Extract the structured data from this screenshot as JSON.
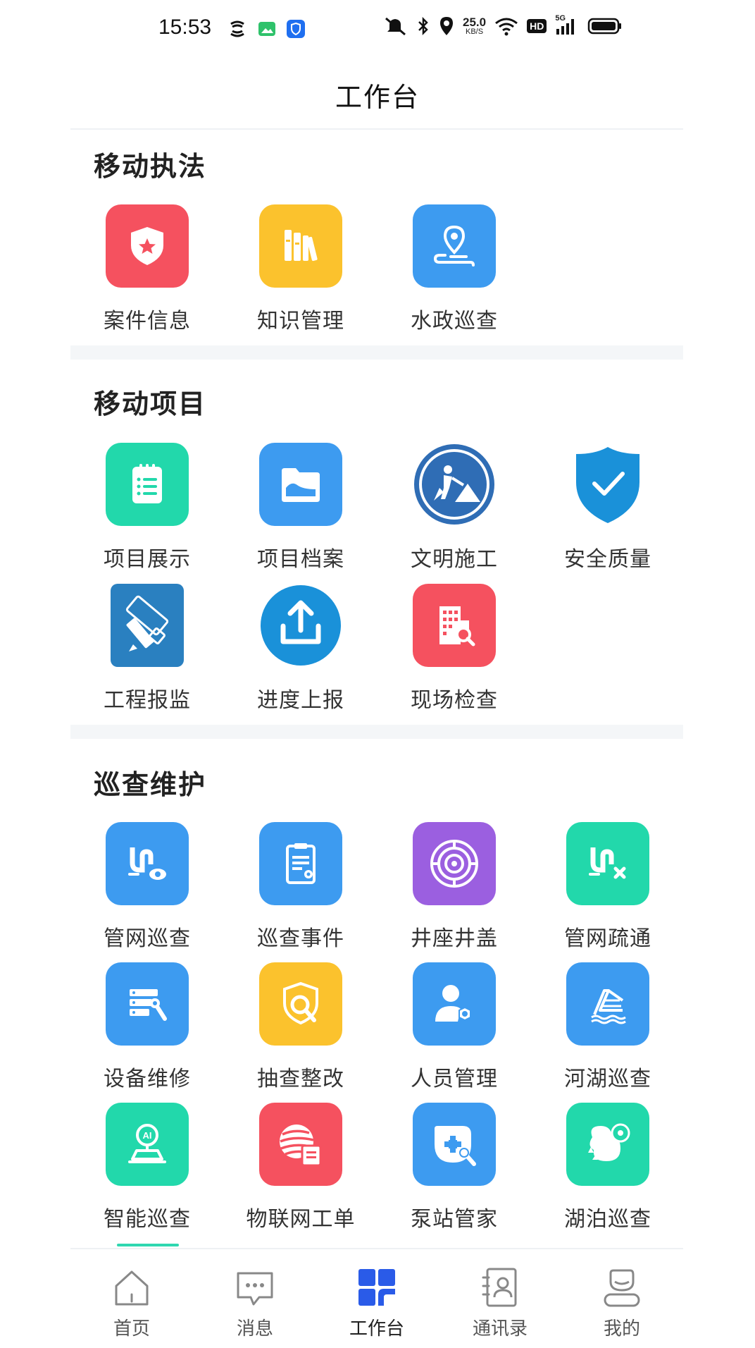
{
  "status_bar": {
    "time": "15:53",
    "network_speed_value": "25.0",
    "network_speed_unit": "KB/S",
    "network_type": "5G",
    "hd_badge": "HD",
    "icons": [
      "nfc-icon",
      "gallery-icon",
      "shield-app-icon",
      "mute-icon",
      "bluetooth-icon",
      "location-icon",
      "wifi-icon",
      "signal-icon",
      "battery-icon"
    ]
  },
  "header": {
    "title": "工作台"
  },
  "sections": [
    {
      "title": "移动执法",
      "items": [
        {
          "label": "案件信息",
          "icon": "police-shield-icon",
          "color": "#f5515f"
        },
        {
          "label": "知识管理",
          "icon": "books-icon",
          "color": "#fbc22d"
        },
        {
          "label": "水政巡查",
          "icon": "map-pin-route-icon",
          "color": "#3d9bf0"
        }
      ]
    },
    {
      "title": "移动项目",
      "items": [
        {
          "label": "项目展示",
          "icon": "clipboard-list-icon",
          "color": "#22d8ab"
        },
        {
          "label": "项目档案",
          "icon": "folder-icon",
          "color": "#3d9bf0"
        },
        {
          "label": "文明施工",
          "icon": "construction-sign-icon",
          "color": "#2f6db5"
        },
        {
          "label": "安全质量",
          "icon": "shield-check-icon",
          "color": "#1a91d9"
        },
        {
          "label": "工程报监",
          "icon": "pencil-ruler-icon",
          "color": "#2a80c0"
        },
        {
          "label": "进度上报",
          "icon": "upload-icon",
          "color": "#1a91d9"
        },
        {
          "label": "现场检查",
          "icon": "building-search-icon",
          "color": "#f5515f"
        }
      ]
    },
    {
      "title": "巡查维护",
      "items": [
        {
          "label": "管网巡查",
          "icon": "pipe-eye-icon",
          "color": "#3d9bf0"
        },
        {
          "label": "巡查事件",
          "icon": "document-eye-icon",
          "color": "#3d9bf0"
        },
        {
          "label": "井座井盖",
          "icon": "manhole-icon",
          "color": "#9b5fe0"
        },
        {
          "label": "管网疏通",
          "icon": "pipe-clean-icon",
          "color": "#22d8ab"
        },
        {
          "label": "设备维修",
          "icon": "server-wrench-icon",
          "color": "#3d9bf0"
        },
        {
          "label": "抽查整改",
          "icon": "shield-search-icon",
          "color": "#fbc22d"
        },
        {
          "label": "人员管理",
          "icon": "user-gear-icon",
          "color": "#3d9bf0"
        },
        {
          "label": "河湖巡查",
          "icon": "river-icon",
          "color": "#3d9bf0"
        },
        {
          "label": "智能巡查",
          "icon": "ai-pin-icon",
          "color": "#22d8ab"
        },
        {
          "label": "物联网工单",
          "icon": "iot-globe-icon",
          "color": "#f5515f"
        },
        {
          "label": "泵站管家",
          "icon": "pump-wrench-icon",
          "color": "#3d9bf0"
        },
        {
          "label": "湖泊巡查",
          "icon": "lake-icon",
          "color": "#22d8ab"
        }
      ]
    }
  ],
  "tab_bar": {
    "active": "工作台",
    "accent": "#2a5be8",
    "items": [
      {
        "label": "首页",
        "icon": "home-icon"
      },
      {
        "label": "消息",
        "icon": "message-icon"
      },
      {
        "label": "工作台",
        "icon": "workbench-grid-icon"
      },
      {
        "label": "通讯录",
        "icon": "contacts-icon"
      },
      {
        "label": "我的",
        "icon": "profile-icon"
      }
    ]
  }
}
